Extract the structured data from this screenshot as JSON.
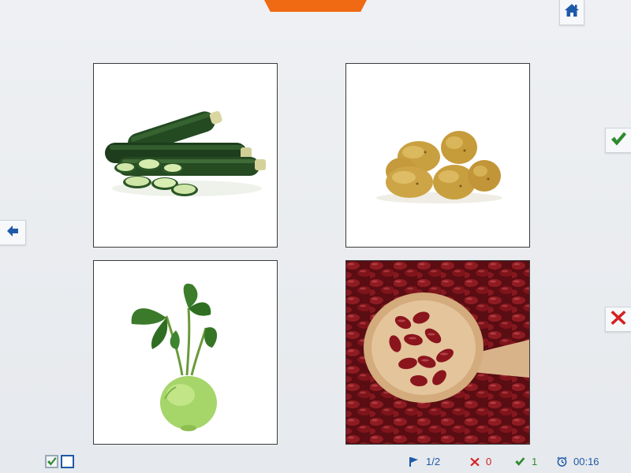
{
  "icons": {
    "home": "home-icon",
    "back": "arrow-left-icon",
    "confirm": "checkmark-icon",
    "reject": "cross-icon",
    "page": "flag-icon",
    "wrong": "cross-icon",
    "right": "checkmark-icon",
    "timer": "clock-icon"
  },
  "cards": [
    {
      "image": "zucchini"
    },
    {
      "image": "potatoes"
    },
    {
      "image": "kohlrabi"
    },
    {
      "image": "kidney-beans-spoon"
    }
  ],
  "status": {
    "page": "1/2",
    "wrong_count": "0",
    "right_count": "1",
    "timer": "00:16"
  },
  "colors": {
    "accent_orange": "#ef6a12",
    "primary_blue": "#1e5aa8",
    "confirm_green": "#2f8a2f",
    "reject_red": "#d42020"
  }
}
